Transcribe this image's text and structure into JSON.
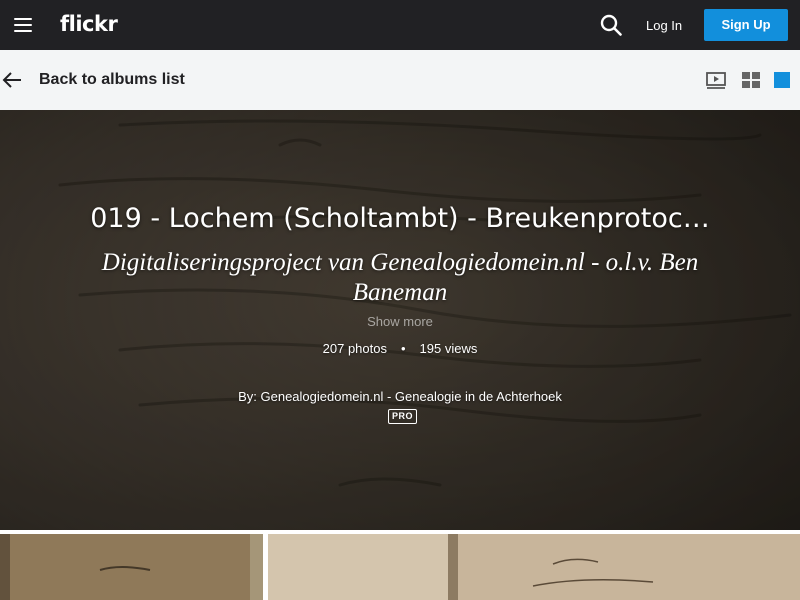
{
  "topbar": {
    "logo": "flickr",
    "login_label": "Log In",
    "signup_label": "Sign Up",
    "icons": [
      "menu-icon",
      "search-icon"
    ],
    "accent_color": "#128fdc",
    "background_color": "#212124"
  },
  "subbar": {
    "back_label": "Back to albums list",
    "icons": [
      "back-arrow-icon",
      "slideshow-icon",
      "grid-view-icon",
      "square-view-icon"
    ],
    "active_view": "square-view"
  },
  "album": {
    "title": "019 - Lochem (Scholtambt) - Breukenprotoc…",
    "description": "Digitaliseringsproject van Genealogiedomein.nl - o.l.v. Ben Baneman",
    "show_more": "Show more",
    "photo_count": "207 photos",
    "separator": "•",
    "view_count": "195 views",
    "owner": "By: Genealogiedomein.nl - Genealogie in de Achterhoek",
    "pro_badge": "PRO"
  },
  "thumbnails": [
    {
      "name": "thumbnail-1",
      "color": "#9c8461"
    },
    {
      "name": "thumbnail-2",
      "color": "#c8b59b"
    }
  ]
}
